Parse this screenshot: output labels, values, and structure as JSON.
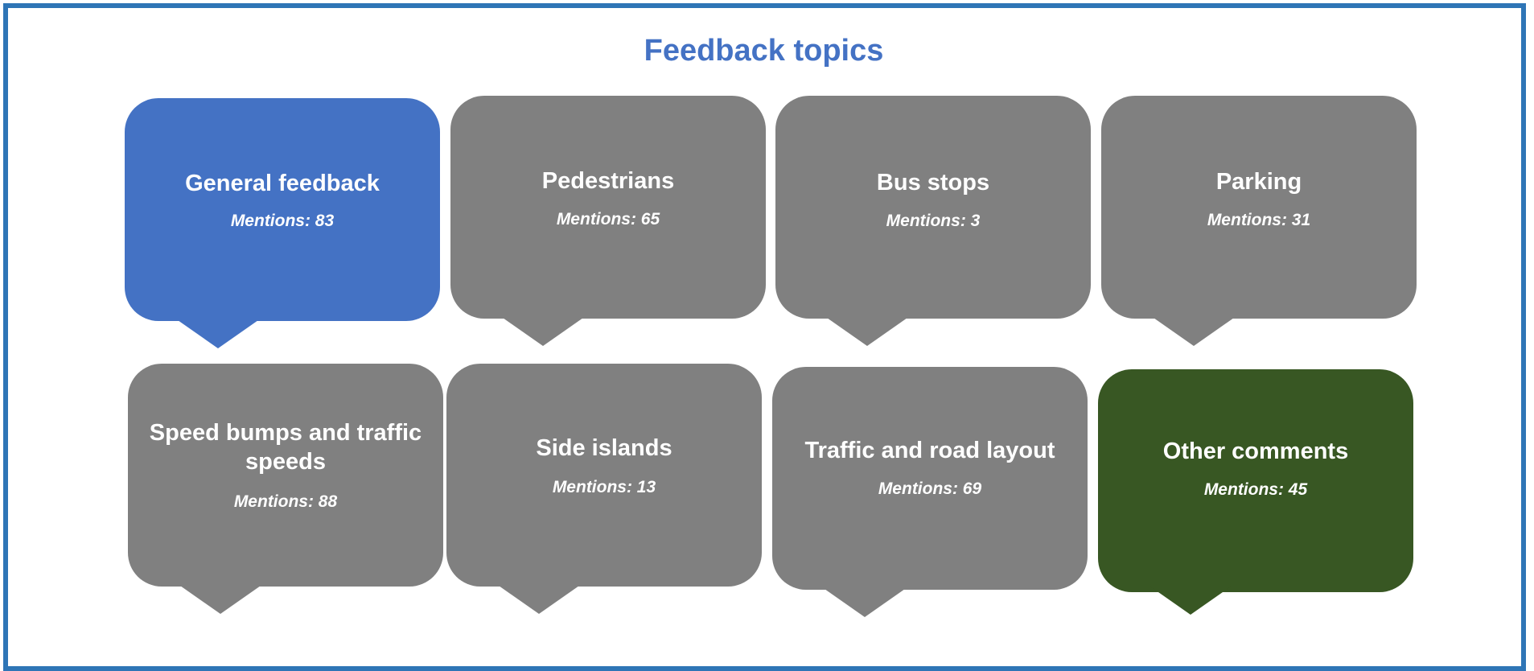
{
  "title": "Feedback topics",
  "colors": {
    "frame": "#2E75B6",
    "title": "#4472C4",
    "blue": "#4472C4",
    "grey": "#808080",
    "green": "#385723"
  },
  "topics": [
    {
      "label": "General feedback",
      "mentions_text": "Mentions: 83",
      "mentions": 83
    },
    {
      "label": "Pedestrians",
      "mentions_text": "Mentions: 65",
      "mentions": 65
    },
    {
      "label": "Bus stops",
      "mentions_text": "Mentions: 3",
      "mentions": 3
    },
    {
      "label": "Parking",
      "mentions_text": "Mentions: 31",
      "mentions": 31
    },
    {
      "label": "Speed bumps and traffic speeds",
      "mentions_text": "Mentions: 88",
      "mentions": 88
    },
    {
      "label": "Side islands",
      "mentions_text": "Mentions: 13",
      "mentions": 13
    },
    {
      "label": "Traffic and road layout",
      "mentions_text": "Mentions: 69",
      "mentions": 69
    },
    {
      "label": "Other comments",
      "mentions_text": "Mentions: 45",
      "mentions": 45
    }
  ]
}
